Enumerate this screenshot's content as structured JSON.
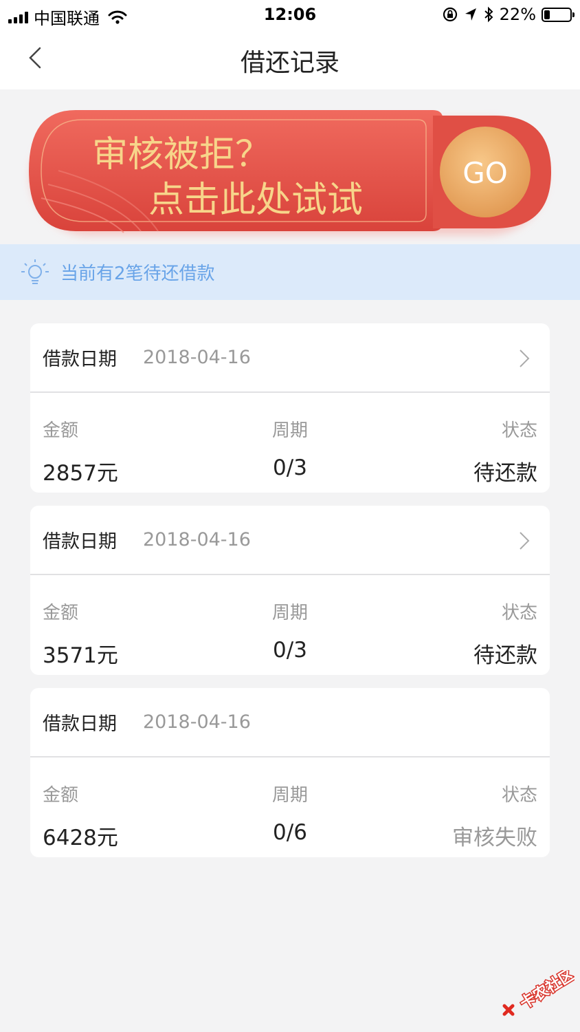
{
  "status_bar": {
    "carrier": "中国联通",
    "time": "12:06",
    "battery": "22%",
    "battery_level": 0.22
  },
  "nav": {
    "title": "借还记录"
  },
  "banner": {
    "line1": "审核被拒？",
    "line2": "点击此处试试",
    "go_label": "GO"
  },
  "notice": {
    "text": "当前有2笔待还借款"
  },
  "loans": [
    {
      "date_label": "借款日期",
      "date": "2018-04-16",
      "amount_label": "金额",
      "amount": "2857元",
      "period_label": "周期",
      "period": "0/3",
      "status_label": "状态",
      "status": "待还款"
    },
    {
      "date_label": "借款日期",
      "date": "2018-04-16",
      "amount_label": "金额",
      "amount": "3571元",
      "period_label": "周期",
      "period": "0/3",
      "status_label": "状态",
      "status": "待还款"
    },
    {
      "date_label": "借款日期",
      "date": "2018-04-16",
      "amount_label": "金额",
      "amount": "6428元",
      "period_label": "周期",
      "period": "0/6",
      "status_label": "状态",
      "status": "审核失败"
    }
  ],
  "watermark": {
    "text": "卡农社区"
  },
  "colors": {
    "banner_red": "#e8564c",
    "banner_gold": "#f7d58a",
    "notice_bg": "#dceafa",
    "notice_text": "#69a4e8"
  }
}
